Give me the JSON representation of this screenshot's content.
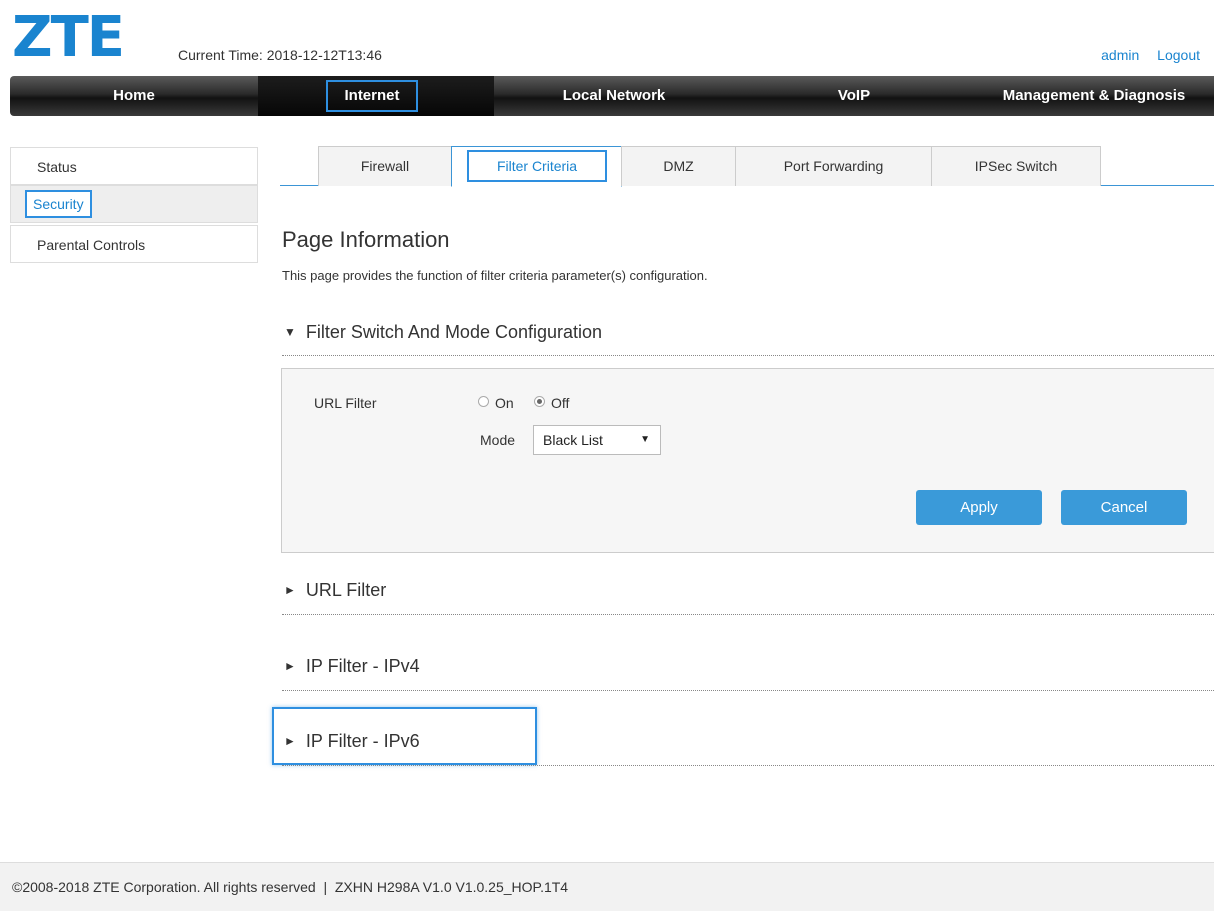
{
  "header": {
    "logo": "ZTE",
    "current_time": "Current Time: 2018-12-12T13:46",
    "user": "admin",
    "logout": "Logout"
  },
  "nav": {
    "items": [
      "Home",
      "Internet",
      "Local Network",
      "VoIP",
      "Management & Diagnosis"
    ],
    "active": "Internet"
  },
  "left_menu": {
    "items": [
      "Status",
      "Security",
      "Parental Controls"
    ],
    "active": "Security"
  },
  "tabs": {
    "items": [
      "Firewall",
      "Filter Criteria",
      "DMZ",
      "Port Forwarding",
      "IPSec Switch"
    ],
    "active": "Filter Criteria"
  },
  "page_info": {
    "title": "Page Information",
    "description": "This page provides the function of filter criteria parameter(s) configuration."
  },
  "sections": {
    "filter_switch": {
      "title": "Filter Switch And Mode Configuration",
      "expanded": true,
      "url_filter_label": "URL Filter",
      "radio_on": "On",
      "radio_off": "Off",
      "selected": "Off",
      "mode_label": "Mode",
      "mode_value": "Black List",
      "apply": "Apply",
      "cancel": "Cancel"
    },
    "url_filter": {
      "title": "URL Filter",
      "expanded": false
    },
    "ip_filter_v4": {
      "title": "IP Filter - IPv4",
      "expanded": false
    },
    "ip_filter_v6": {
      "title": "IP Filter - IPv6",
      "expanded": false
    }
  },
  "footer": {
    "text": "©2008-2018 ZTE Corporation. All rights reserved  |  ZXHN H298A V1.0 V1.0.25_HOP.1T4"
  },
  "colors": {
    "accent": "#1a84cf",
    "highlight_border": "#2e8fe0",
    "button": "#3a9ad9",
    "nav_bg": "#1e1e1e"
  }
}
